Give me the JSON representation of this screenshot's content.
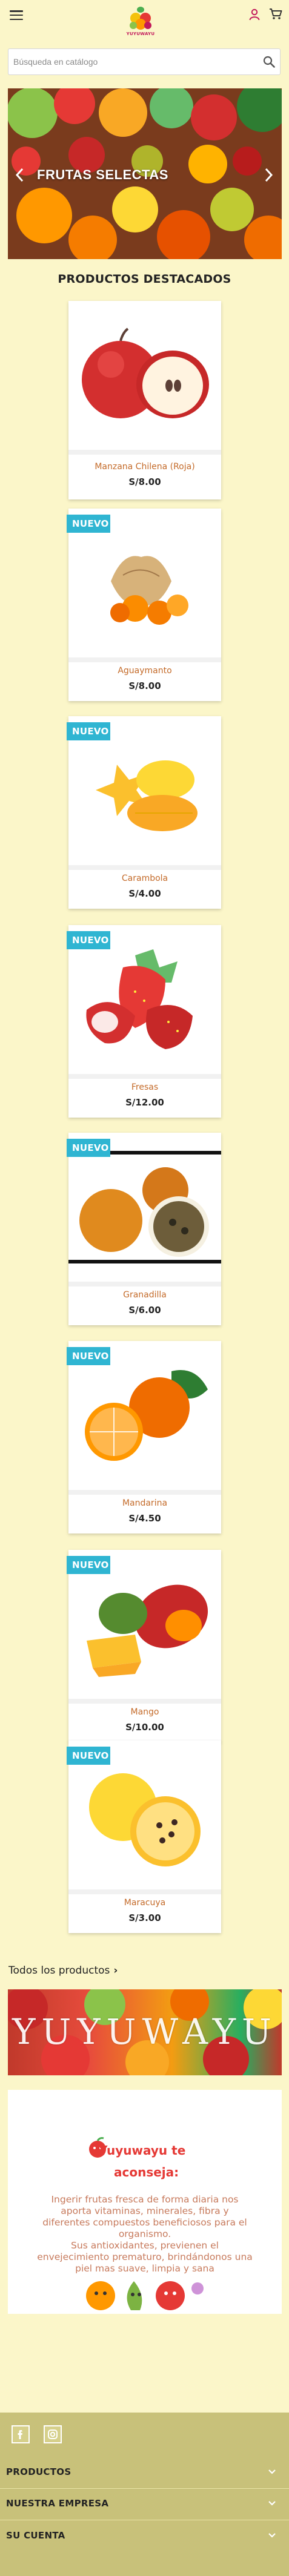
{
  "header": {
    "logo_text": "YUYUWAYU",
    "search": {
      "placeholder": "Búsqueda en catálogo",
      "value": ""
    }
  },
  "hero": {
    "caption": "FRUTAS SELECTAS"
  },
  "featured": {
    "title": "PRODUCTOS DESTACADOS",
    "badge_label": "NUEVO",
    "products": [
      {
        "name": "Manzana Chilena (Roja)",
        "price": "S/8.00",
        "is_new": false,
        "image": "red-apple"
      },
      {
        "name": "Aguaymanto",
        "price": "S/8.00",
        "is_new": true,
        "image": "physalis"
      },
      {
        "name": "Carambola",
        "price": "S/4.00",
        "is_new": true,
        "image": "star-fruit"
      },
      {
        "name": "Fresas",
        "price": "S/12.00",
        "is_new": true,
        "image": "strawberries"
      },
      {
        "name": "Granadilla",
        "price": "S/6.00",
        "is_new": true,
        "image": "granadilla"
      },
      {
        "name": "Mandarina",
        "price": "S/4.50",
        "is_new": true,
        "image": "tangerine"
      },
      {
        "name": "Mango",
        "price": "S/10.00",
        "is_new": true,
        "image": "mango"
      },
      {
        "name": "Maracuya",
        "price": "S/3.00",
        "is_new": true,
        "image": "passion-fruit"
      }
    ],
    "all_products_label": "Todos los productos"
  },
  "banner": {
    "text": "YUYUWAYU"
  },
  "advice": {
    "title_line1": "Yuyuwayu te",
    "title_line2": "aconseja:",
    "paragraph1": "Ingerir frutas fresca de forma diaria nos aporta vitaminas, minerales, fibra y diferentes compuestos beneficiosos para el organismo.",
    "paragraph2": "Sus antioxidantes, previenen el envejecimiento prematuro, brindándonos una piel mas suave, limpia y sana"
  },
  "footer": {
    "social": [
      "facebook-icon",
      "instagram-icon"
    ],
    "rows": [
      {
        "label": "PRODUCTOS"
      },
      {
        "label": "NUESTRA EMPRESA"
      },
      {
        "label": "SU CUENTA"
      }
    ]
  },
  "colors": {
    "page_bg": "#fbf6c9",
    "footer_bg": "#c8c17a",
    "badge": "#2fb5d2",
    "product_name": "#c46b2a",
    "advice_title": "#e53935",
    "advice_text": "#c77a5c"
  }
}
